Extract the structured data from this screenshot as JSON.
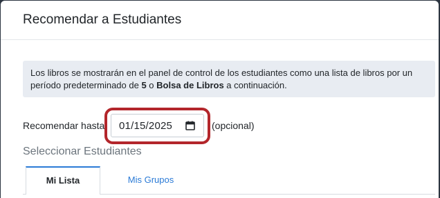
{
  "dialog": {
    "title": "Recomendar a Estudiantes"
  },
  "info": {
    "text_before": "Los libros se mostrarán en el panel de control de los estudiantes como una lista de libros por un período predeterminado de ",
    "default_days": "5",
    "text_middle": " o ",
    "bag_label": "Bolsa de Libros",
    "text_after": " a continuación."
  },
  "recommend_until": {
    "label": "Recomendar hasta",
    "date_value": "01/15/2025",
    "optional_label": "(opcional)",
    "calendar_icon": "calendar-icon",
    "highlight_color": "#b3262b"
  },
  "students": {
    "heading": "Seleccionar Estudiantes",
    "tabs": [
      {
        "label": "Mi Lista",
        "active": true
      },
      {
        "label": "Mis Grupos",
        "active": false
      }
    ]
  },
  "colors": {
    "accent": "#2a7ad6",
    "info_bg": "#e8ecf2",
    "backdrop": "#2c3540"
  }
}
